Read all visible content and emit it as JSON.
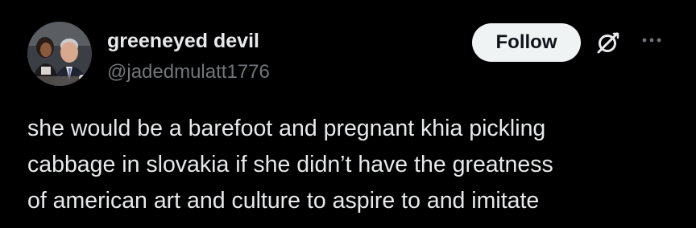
{
  "author": {
    "display_name": "greeneyed devil",
    "handle": "@jadedmulatt1776",
    "avatar_icon": "profile-photo"
  },
  "actions": {
    "follow_label": "Follow",
    "grok_icon": "grok-slash-icon",
    "more_icon": "more-options-icon"
  },
  "tweet": {
    "lines": [
      "she would be a barefoot and pregnant khia pickling",
      "cabbage in slovakia if she didn’t have the greatness",
      "of american art and culture to aspire to and imitate"
    ]
  },
  "colors": {
    "background": "#000000",
    "text_primary": "#e7e9ea",
    "text_secondary": "#71767b",
    "follow_bg": "#eff3f4",
    "follow_text": "#0f1419"
  }
}
